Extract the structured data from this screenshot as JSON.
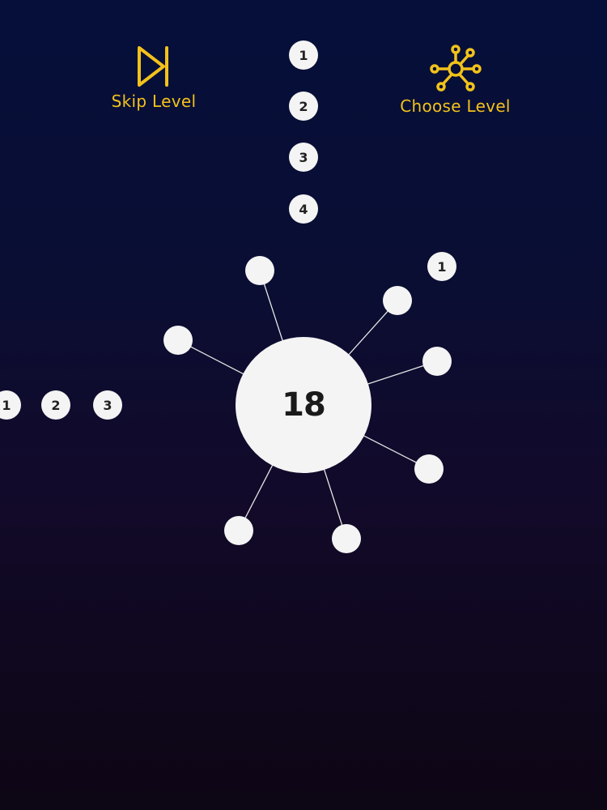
{
  "colors": {
    "accent": "#f2c21b",
    "ball": "#f4f4f4",
    "grid_top": "#243a8a",
    "grid_bottom": "#6a1838"
  },
  "menu": {
    "skip": {
      "label": "Skip Level",
      "icon": "skip-forward-icon"
    },
    "choose": {
      "label": "Choose Level",
      "icon": "network-nodes-icon"
    }
  },
  "hub": {
    "value": "18"
  },
  "queue_top": [
    "1",
    "2",
    "3",
    "4"
  ],
  "queue_left": [
    "1",
    "2",
    "3"
  ],
  "flying_ball": "1"
}
